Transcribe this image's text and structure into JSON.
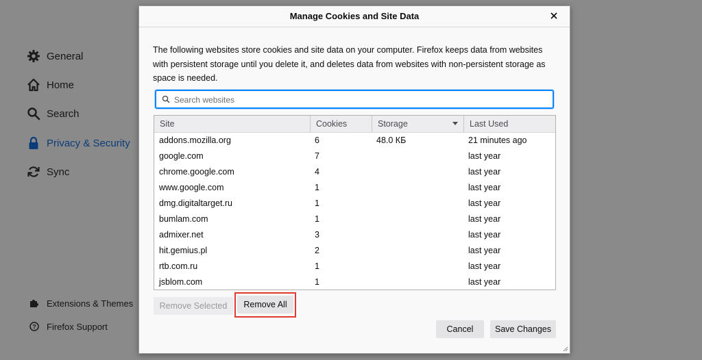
{
  "sidebar": {
    "items": [
      {
        "label": "General",
        "icon": "gear-icon"
      },
      {
        "label": "Home",
        "icon": "home-icon"
      },
      {
        "label": "Search",
        "icon": "search-icon"
      },
      {
        "label": "Privacy & Security",
        "icon": "lock-icon",
        "selected": true
      },
      {
        "label": "Sync",
        "icon": "sync-icon"
      }
    ],
    "footer": [
      {
        "label": "Extensions & Themes",
        "icon": "puzzle-icon"
      },
      {
        "label": "Firefox Support",
        "icon": "help-icon"
      }
    ]
  },
  "dialog": {
    "title": "Manage Cookies and Site Data",
    "description": "The following websites store cookies and site data on your computer. Firefox keeps data from websites with persistent storage until you delete it, and deletes data from websites with non-persistent storage as space is needed.",
    "search": {
      "placeholder": "Search websites",
      "value": ""
    },
    "table": {
      "columns": [
        "Site",
        "Cookies",
        "Storage",
        "Last Used"
      ],
      "sorted_column": "Storage",
      "rows": [
        {
          "site": "addons.mozilla.org",
          "cookies": "6",
          "storage": "48.0 КБ",
          "last_used": "21 minutes ago"
        },
        {
          "site": "google.com",
          "cookies": "7",
          "storage": "",
          "last_used": "last year"
        },
        {
          "site": "chrome.google.com",
          "cookies": "4",
          "storage": "",
          "last_used": "last year"
        },
        {
          "site": "www.google.com",
          "cookies": "1",
          "storage": "",
          "last_used": "last year"
        },
        {
          "site": "dmg.digitaltarget.ru",
          "cookies": "1",
          "storage": "",
          "last_used": "last year"
        },
        {
          "site": "bumlam.com",
          "cookies": "1",
          "storage": "",
          "last_used": "last year"
        },
        {
          "site": "admixer.net",
          "cookies": "3",
          "storage": "",
          "last_used": "last year"
        },
        {
          "site": "hit.gemius.pl",
          "cookies": "2",
          "storage": "",
          "last_used": "last year"
        },
        {
          "site": "rtb.com.ru",
          "cookies": "1",
          "storage": "",
          "last_used": "last year"
        },
        {
          "site": "jsblom.com",
          "cookies": "1",
          "storage": "",
          "last_used": "last year"
        }
      ]
    },
    "buttons": {
      "remove_selected": "Remove Selected",
      "remove_all": "Remove All",
      "cancel": "Cancel",
      "save_changes": "Save Changes"
    },
    "highlight_color": "#e03a2f",
    "focus_color": "#0a84ff"
  }
}
